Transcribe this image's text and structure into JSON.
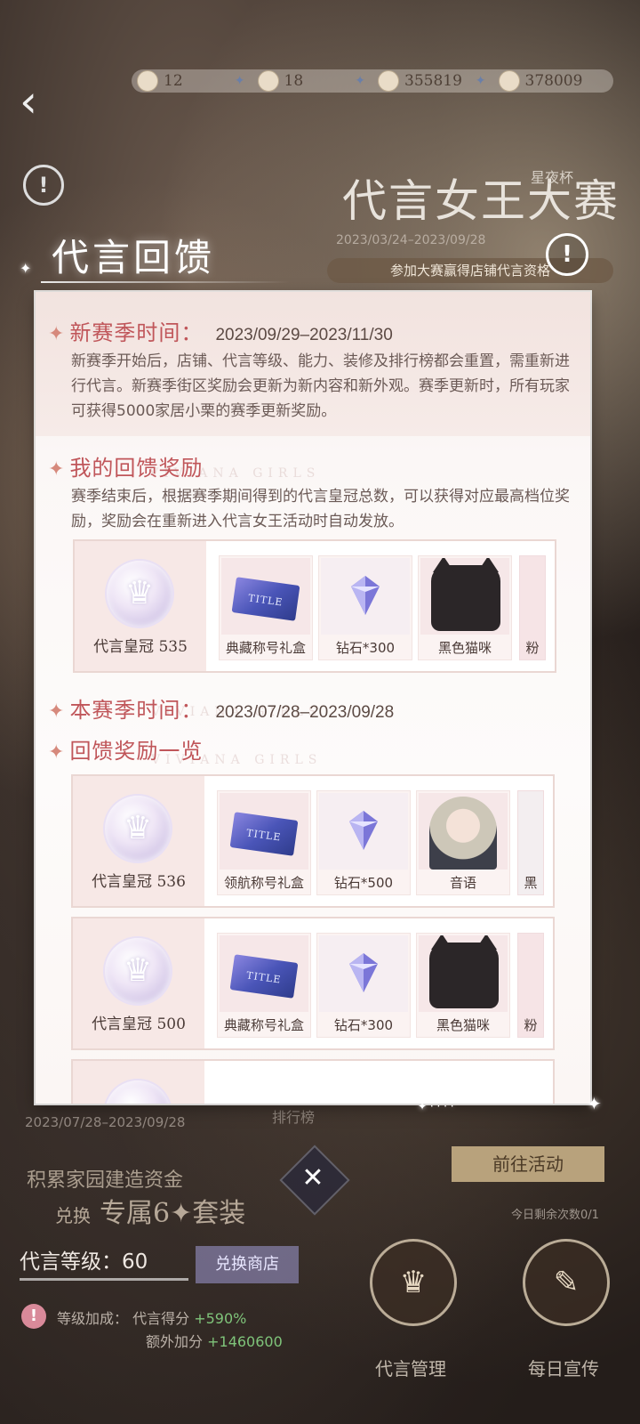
{
  "resources": [
    {
      "icon": "pearl-icon",
      "value": "12"
    },
    {
      "icon": "crown-icon",
      "value": "18"
    },
    {
      "icon": "acorn-icon",
      "value": "355819"
    },
    {
      "icon": "coin-icon",
      "value": "378009"
    }
  ],
  "event": {
    "title": "代言女王大赛",
    "cup": "星夜杯",
    "dates": "2023/03/24–2023/09/28",
    "banner": "参加大赛赢得店铺代言资格"
  },
  "panel": {
    "header": "代言回馈",
    "new_season": {
      "label": "新赛季时间：",
      "date": "2023/09/29–2023/11/30",
      "body": "新赛季开始后，店铺、代言等级、能力、装修及排行榜都会重置，需重新进行代言。新赛季街区奖励会更新为新内容和新外观。赛季更新时，所有玩家可获得5000家居小栗的赛季更新奖励。"
    },
    "my_rewards": {
      "label": "我的回馈奖励",
      "body": "赛季结束后，根据赛季期间得到的代言皇冠总数，可以获得对应最高档位奖励，奖励会在重新进入代言女王活动时自动发放。",
      "crown_label": "代言皇冠",
      "crown_count": "535",
      "items": [
        "典藏称号礼盒",
        "钻石*300",
        "黑色猫咪",
        "粉"
      ]
    },
    "this_season": {
      "label": "本赛季时间：",
      "date": "2023/07/28–2023/09/28"
    },
    "reward_list": {
      "label": "回馈奖励一览",
      "tiers": [
        {
          "crown_label": "代言皇冠",
          "crown_count": "536",
          "items": [
            "领航称号礼盒",
            "钻石*500",
            "音语",
            "黑"
          ]
        },
        {
          "crown_label": "代言皇冠",
          "crown_count": "500",
          "items": [
            "典藏称号礼盒",
            "钻石*300",
            "黑色猫咪",
            "粉"
          ]
        }
      ]
    },
    "ghost_text": "VIVIANA GIRLS",
    "title_card_text": "TITLE"
  },
  "background": {
    "range": "2023/07/28–2023/09/28",
    "rank": "排行榜",
    "goto": "前往活动",
    "today_left": "今日剩余次数0/1",
    "accumulate": "积累家园建造资金",
    "exchange_small": "兑换",
    "exchange_big": "专属6",
    "exchange_suffix": "套装",
    "level": "代言等级：60",
    "shop": "兑换商店",
    "bonus1_label": "等级加成：",
    "bonus1_name": "代言得分",
    "bonus1_value": "+590%",
    "bonus2_name": "额外加分",
    "bonus2_value": "+1460600",
    "manage": "代言管理",
    "daily": "每日宣传"
  },
  "colors": {
    "accent": "#c0565a",
    "star": "#d6897c",
    "goto_button": "#b8a27c"
  }
}
